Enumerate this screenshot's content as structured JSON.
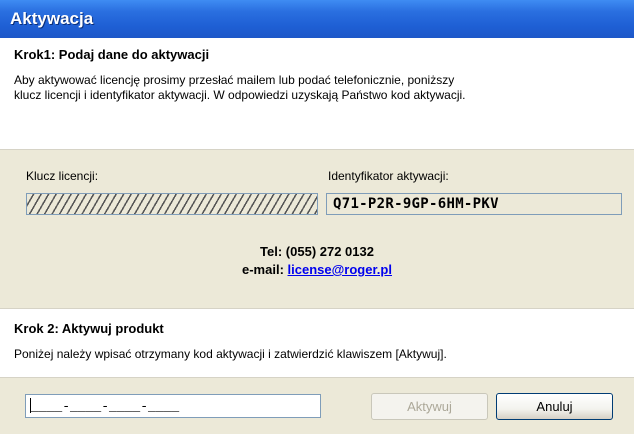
{
  "window": {
    "title": "Aktywacja"
  },
  "step1": {
    "heading": "Krok1: Podaj dane do aktywacji",
    "line1": "Aby aktywować licencję prosimy przesłać mailem  lub podać telefonicznie, poniższy",
    "line2": "klucz licencji i identyfikator aktywacji. W odpowiedzi uzyskają Państwo kod aktywacji."
  },
  "license": {
    "label": "Klucz licencji:"
  },
  "activation_id": {
    "label": "Identyfikator aktywacji:",
    "value": "Q71-P2R-9GP-6HM-PKV"
  },
  "contact": {
    "tel_label": "Tel:",
    "tel_value": "(055) 272 0132",
    "email_label": "e-mail:",
    "email_value": "license@roger.pl"
  },
  "step2": {
    "heading": "Krok 2: Aktywuj produkt",
    "text": "Poniżej należy wpisać otrzymany kod aktywacji i zatwierdzić klawiszem [Aktywuj]."
  },
  "code_input": {
    "mask": "____-____-____-____"
  },
  "buttons": {
    "activate": "Aktywuj",
    "cancel": "Anuluj"
  },
  "colors": {
    "titlebar": "#2a6fe0",
    "link": "#0000ee",
    "dialog_bg": "#ece9d8"
  }
}
